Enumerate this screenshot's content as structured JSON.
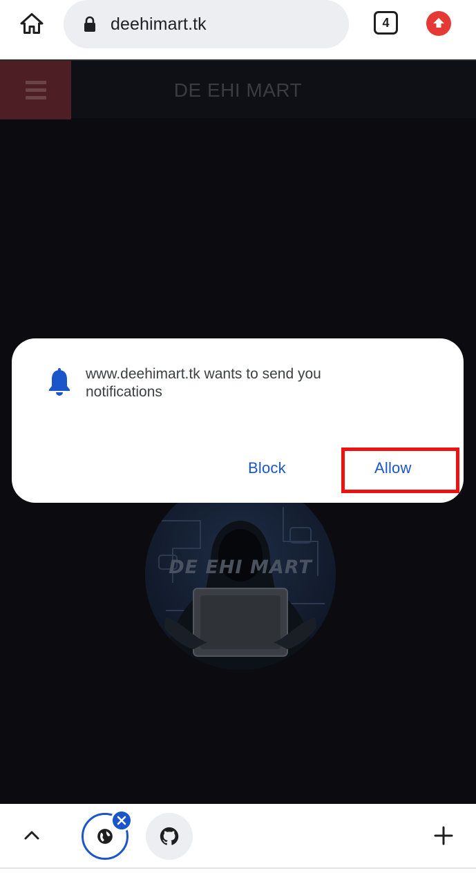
{
  "browser": {
    "url": "deehimart.tk",
    "tab_count": "4"
  },
  "site": {
    "header_title": "DE EHI MART",
    "logo_text": "DE EHI MART"
  },
  "dialog": {
    "message": "www.deehimart.tk wants to send you notifications",
    "block_label": "Block",
    "allow_label": "Allow"
  },
  "colors": {
    "accent": "#1a56c9",
    "highlight": "#ee1111",
    "menu_bg": "#4e1e25",
    "page_bg": "#0b0b10"
  },
  "icons": {
    "home": "home-icon",
    "lock": "lock-icon",
    "update": "update-arrow-icon",
    "bell": "bell-icon",
    "tab_chevron": "chevron-up-icon",
    "tab_site": "globe-icon",
    "tab_close": "close-icon",
    "tab_other": "github-icon",
    "new_tab": "plus-icon"
  }
}
